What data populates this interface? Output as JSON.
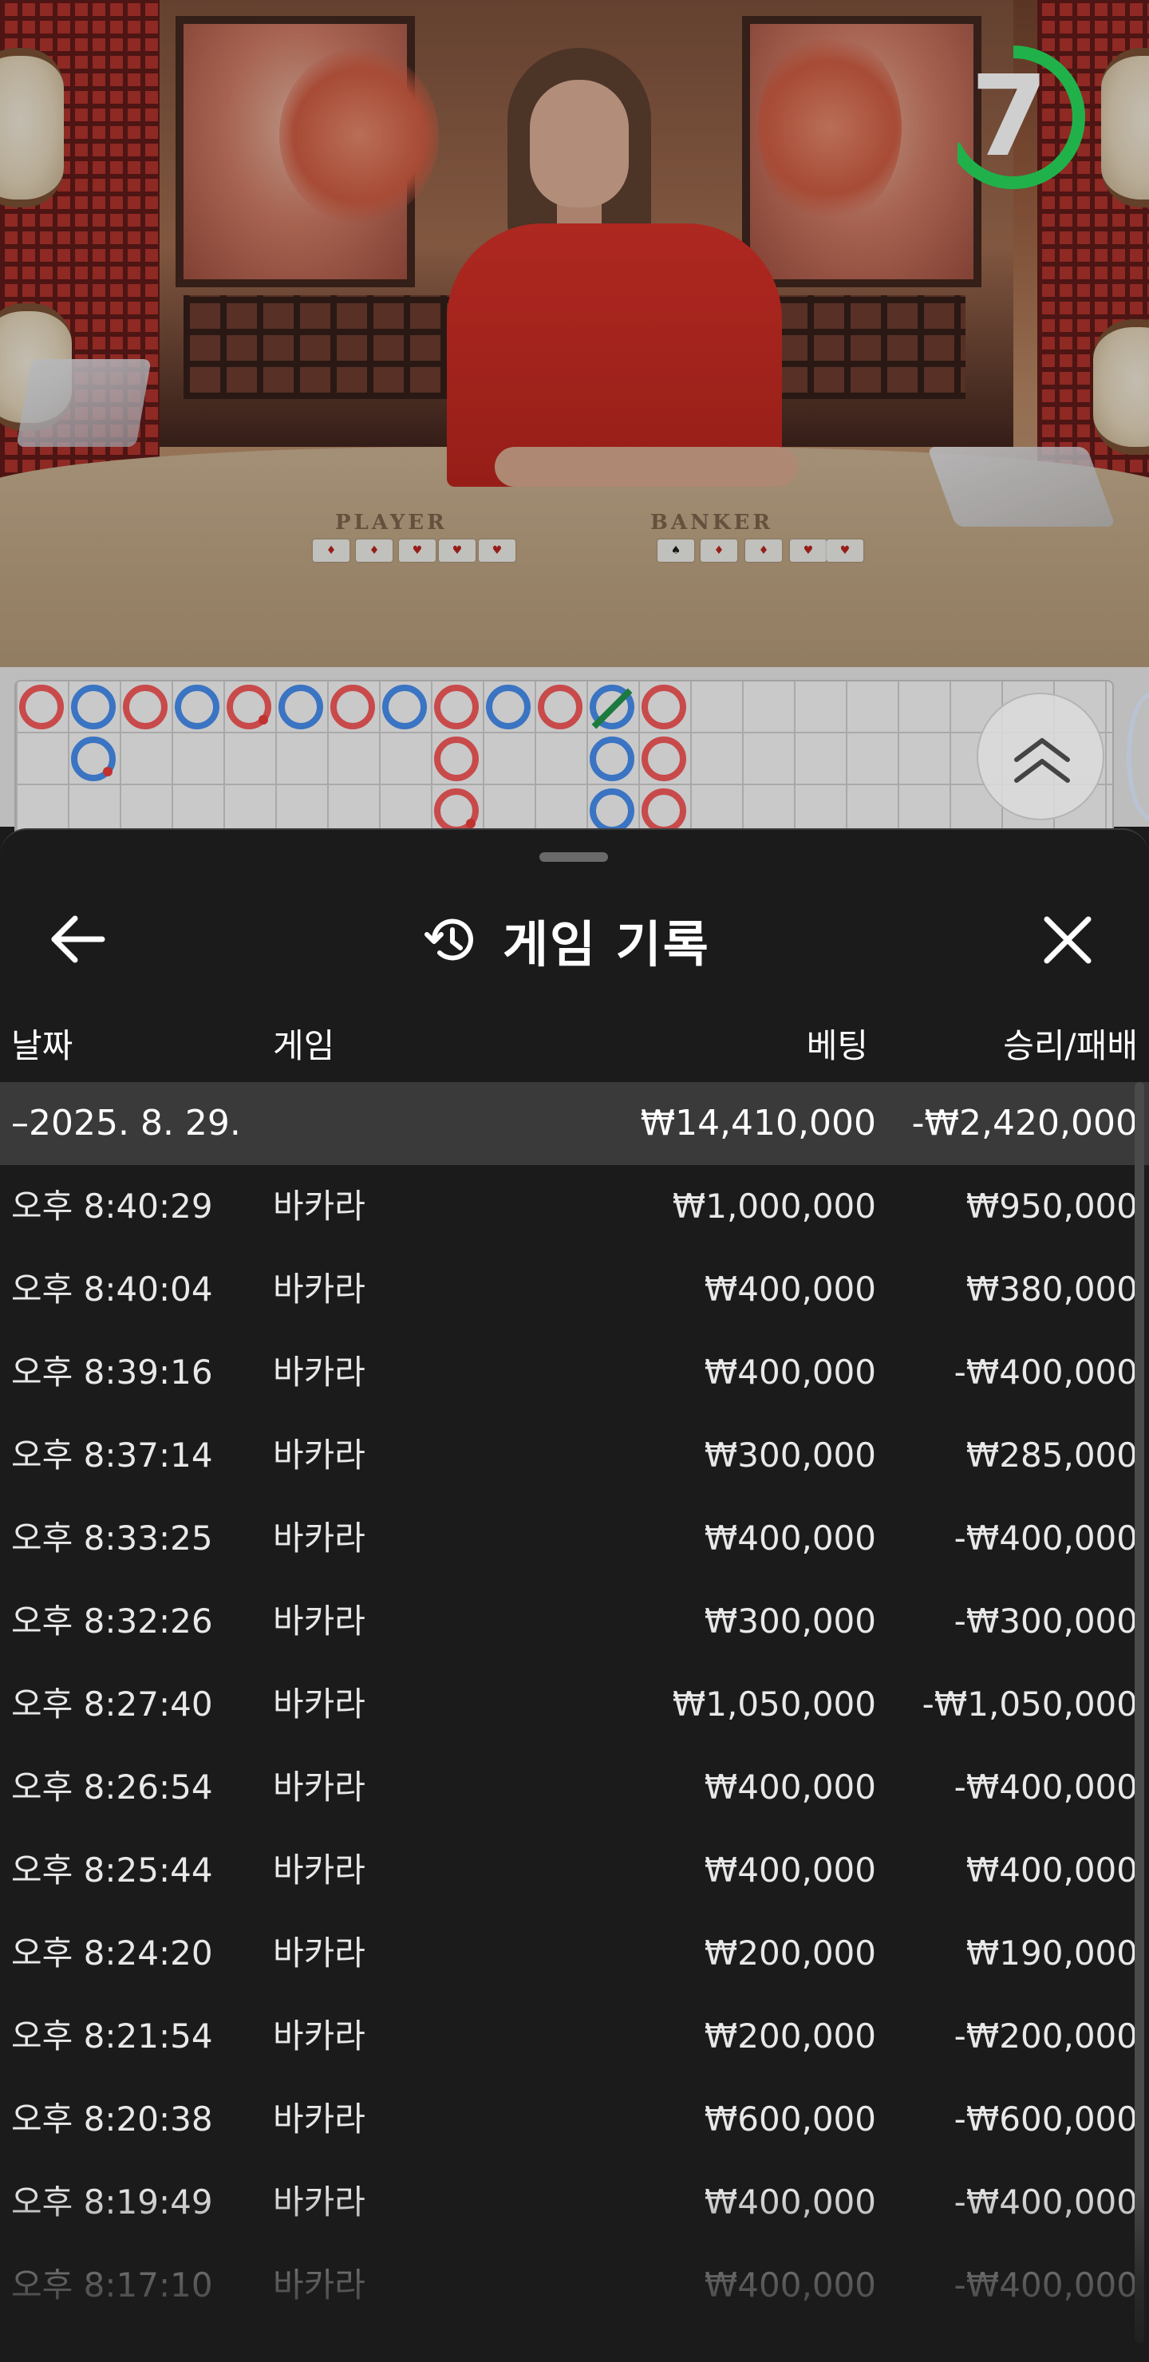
{
  "timer": {
    "seconds": "7",
    "progress": 0.68,
    "color": "#21b14b"
  },
  "roadmap": {
    "player_color": "#3a74c3",
    "banker_color": "#c84a4a",
    "tie_color": "#1c7a3e"
  },
  "sheet": {
    "title": "게임 기록",
    "icons": {
      "back": "arrow-left-icon",
      "history": "history-icon",
      "close": "close-icon"
    }
  },
  "table": {
    "columns": [
      "날짜",
      "게임",
      "베팅",
      "승리/패배"
    ],
    "date_group": {
      "label": "–2025. 8. 29.",
      "bet": "₩14,410,000",
      "result": "-₩2,420,000"
    },
    "rows": [
      {
        "time": "오후 8:40:29",
        "game": "바카라",
        "bet": "₩1,000,000",
        "result": "₩950,000"
      },
      {
        "time": "오후 8:40:04",
        "game": "바카라",
        "bet": "₩400,000",
        "result": "₩380,000"
      },
      {
        "time": "오후 8:39:16",
        "game": "바카라",
        "bet": "₩400,000",
        "result": "-₩400,000"
      },
      {
        "time": "오후 8:37:14",
        "game": "바카라",
        "bet": "₩300,000",
        "result": "₩285,000"
      },
      {
        "time": "오후 8:33:25",
        "game": "바카라",
        "bet": "₩400,000",
        "result": "-₩400,000"
      },
      {
        "time": "오후 8:32:26",
        "game": "바카라",
        "bet": "₩300,000",
        "result": "-₩300,000"
      },
      {
        "time": "오후 8:27:40",
        "game": "바카라",
        "bet": "₩1,050,000",
        "result": "-₩1,050,000"
      },
      {
        "time": "오후 8:26:54",
        "game": "바카라",
        "bet": "₩400,000",
        "result": "-₩400,000"
      },
      {
        "time": "오후 8:25:44",
        "game": "바카라",
        "bet": "₩400,000",
        "result": "₩400,000"
      },
      {
        "time": "오후 8:24:20",
        "game": "바카라",
        "bet": "₩200,000",
        "result": "₩190,000"
      },
      {
        "time": "오후 8:21:54",
        "game": "바카라",
        "bet": "₩200,000",
        "result": "-₩200,000"
      },
      {
        "time": "오후 8:20:38",
        "game": "바카라",
        "bet": "₩600,000",
        "result": "-₩600,000"
      },
      {
        "time": "오후 8:19:49",
        "game": "바카라",
        "bet": "₩400,000",
        "result": "-₩400,000"
      },
      {
        "time": "오후 8:17:10",
        "game": "바카라",
        "bet": "₩400,000",
        "result": "-₩400,000"
      }
    ]
  },
  "table_labels": {
    "player": "PLAYER",
    "banker": "BANKER"
  }
}
